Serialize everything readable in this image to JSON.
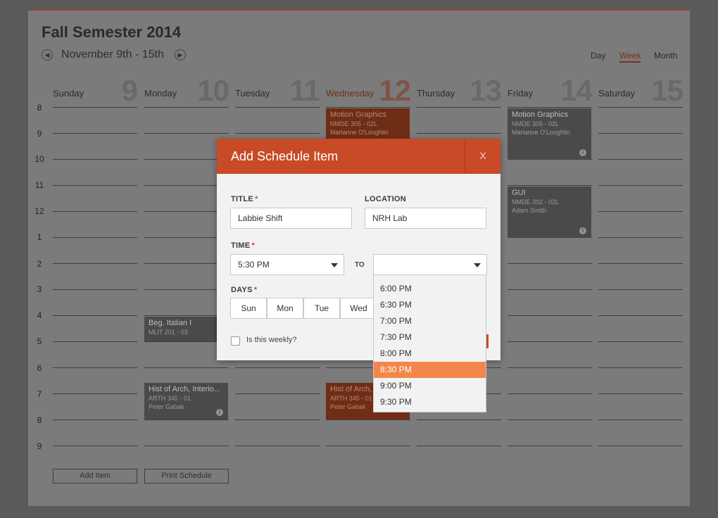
{
  "calendar": {
    "title": "Fall Semester 2014",
    "week_range": "November 9th - 15th",
    "prev_icon": "chevron-left-icon",
    "next_icon": "chevron-right-icon",
    "views": {
      "day": "Day",
      "week": "Week",
      "month": "Month"
    },
    "active_view": "Week",
    "days": [
      {
        "name": "Sunday",
        "num": "9"
      },
      {
        "name": "Monday",
        "num": "10"
      },
      {
        "name": "Tuesday",
        "num": "11"
      },
      {
        "name": "Wednesday",
        "num": "12"
      },
      {
        "name": "Thursday",
        "num": "13"
      },
      {
        "name": "Friday",
        "num": "14"
      },
      {
        "name": "Saturday",
        "num": "15"
      }
    ],
    "hours": [
      "8",
      "9",
      "10",
      "11",
      "12",
      "1",
      "2",
      "3",
      "4",
      "5",
      "6",
      "7",
      "8",
      "9"
    ],
    "events": {
      "wed_motion": {
        "title": "Motion Graphics",
        "code": "NMDE 305 - 02L",
        "person": "Marianne O'Loughlin"
      },
      "fri_motion": {
        "title": "Motion Graphics",
        "code": "NMDE 305 - 02L",
        "person": "Marianne O'Loughlin"
      },
      "fri_gui": {
        "title": "GUI",
        "code": "NMDE 302 - 02L",
        "person": "Adam Smith"
      },
      "mon_italian": {
        "title": "Beg. Italian I",
        "code": "MLIT 201 - 03"
      },
      "mon_arch": {
        "title": "Hist of Arch, Interio...",
        "code": "ARTH 345 - 01",
        "person": "Peter Gabak"
      },
      "wed_arch": {
        "title": "Hist of Arch,",
        "code": "ARTH 345 - 01",
        "person": "Peter Gabak"
      }
    },
    "add_item": "Add Item",
    "print_schedule": "Print Schedule"
  },
  "modal": {
    "title": "Add Schedule Item",
    "close": "X",
    "title_label": "TITLE",
    "title_value": "Labbie Shift",
    "location_label": "LOCATION",
    "location_value": "NRH Lab",
    "time_label": "TIME",
    "time_from": "5:30 PM",
    "to_label": "TO",
    "time_to": "",
    "days_label": "DAYS",
    "day_options": [
      "Sun",
      "Mon",
      "Tue",
      "Wed"
    ],
    "required_mark": "*",
    "weekly_label": "Is this weekly?",
    "weekly_checked": false
  },
  "dropdown": {
    "options": [
      "6:00 PM",
      "6:30 PM",
      "7:00 PM",
      "7:30 PM",
      "8:00 PM",
      "8:30 PM",
      "9:00 PM",
      "9:30 PM"
    ],
    "selected": "8:30 PM"
  },
  "colors": {
    "accent": "#c84a27",
    "highlight": "#f3874b"
  }
}
